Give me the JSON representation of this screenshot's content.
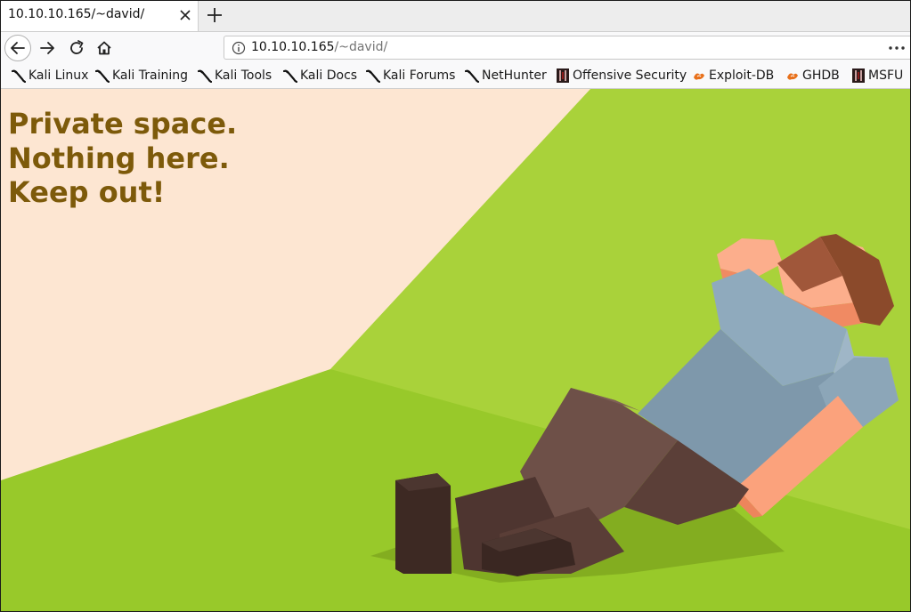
{
  "tab": {
    "title": "10.10.10.165/~david/"
  },
  "urlbar": {
    "host": "10.10.10.165",
    "path": "/~david/"
  },
  "bookmarks": [
    {
      "label": "Kali Linux",
      "icon": "kali-dragon-icon"
    },
    {
      "label": "Kali Training",
      "icon": "kali-dragon-icon"
    },
    {
      "label": "Kali Tools",
      "icon": "kali-dragon-icon"
    },
    {
      "label": "Kali Docs",
      "icon": "kali-dragon-icon"
    },
    {
      "label": "Kali Forums",
      "icon": "kali-dragon-icon"
    },
    {
      "label": "NetHunter",
      "icon": "kali-dragon-icon"
    },
    {
      "label": "Offensive Security",
      "icon": "offsec-icon"
    },
    {
      "label": "Exploit-DB",
      "icon": "exploitdb-icon"
    },
    {
      "label": "GHDB",
      "icon": "exploitdb-icon"
    },
    {
      "label": "MSFU",
      "icon": "offsec-icon"
    }
  ],
  "page": {
    "lines": [
      "Private space.",
      "Nothing here.",
      "Keep out!"
    ],
    "text_color": "#7d5a0a",
    "background_color": "#fde6d2",
    "grass_color": "#9ccc2c"
  }
}
